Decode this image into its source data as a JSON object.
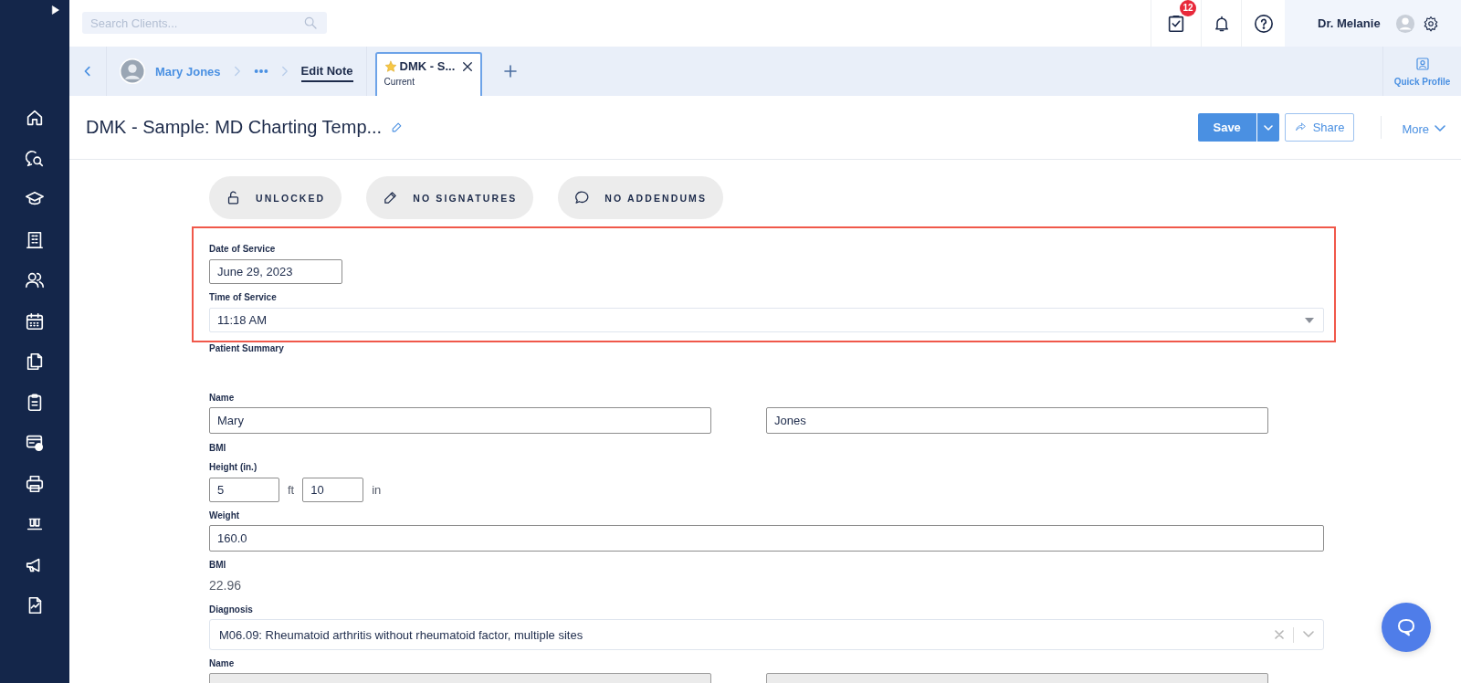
{
  "search": {
    "placeholder": "Search Clients..."
  },
  "top_bar": {
    "tasks_badge": "12",
    "user_name": "Dr. Melanie"
  },
  "breadcrumb": {
    "client": "Mary Jones",
    "current": "Edit Note"
  },
  "tabs": [
    {
      "label": "DMK - S...",
      "sublabel": "Current",
      "selected": true,
      "starred": true
    }
  ],
  "quick_profile": {
    "label": "Quick Profile"
  },
  "note": {
    "title": "DMK - Sample: MD Charting Temp...",
    "actions": [
      {
        "kind": "save",
        "label": "Save"
      },
      {
        "kind": "share",
        "label": "Share"
      },
      {
        "kind": "more",
        "label": "More"
      }
    ]
  },
  "status_pills": [
    {
      "kind": "lock",
      "label": "UNLOCKED"
    },
    {
      "kind": "signature",
      "label": "NO SIGNATURES"
    },
    {
      "kind": "comment",
      "label": "NO ADDENDUMS"
    }
  ],
  "highlighted_fields": [
    {
      "kind": "date",
      "label": "Date of Service",
      "value": "June 29, 2023"
    },
    {
      "kind": "select",
      "label": "Time of Service",
      "value": "11:18 AM"
    }
  ],
  "fields": [
    {
      "kind": "section",
      "label": "Patient Summary"
    },
    {
      "kind": "pair",
      "label": "Name",
      "values": [
        "Mary",
        "Jones"
      ],
      "disabled": false
    },
    {
      "kind": "subheading",
      "label": "BMI"
    },
    {
      "kind": "height",
      "label": "Height (in.)",
      "feet": "5",
      "feet_unit": "ft",
      "inches": "10",
      "inches_unit": "in"
    },
    {
      "kind": "text",
      "label": "Weight",
      "value": "160.0"
    },
    {
      "kind": "static",
      "label": "BMI",
      "value": "22.96"
    },
    {
      "kind": "combo",
      "label": "Diagnosis",
      "value": "M06.09: Rheumatoid arthritis without rheumatoid factor, multiple sites"
    },
    {
      "kind": "pair",
      "label": "Name",
      "disabled": true
    }
  ]
}
